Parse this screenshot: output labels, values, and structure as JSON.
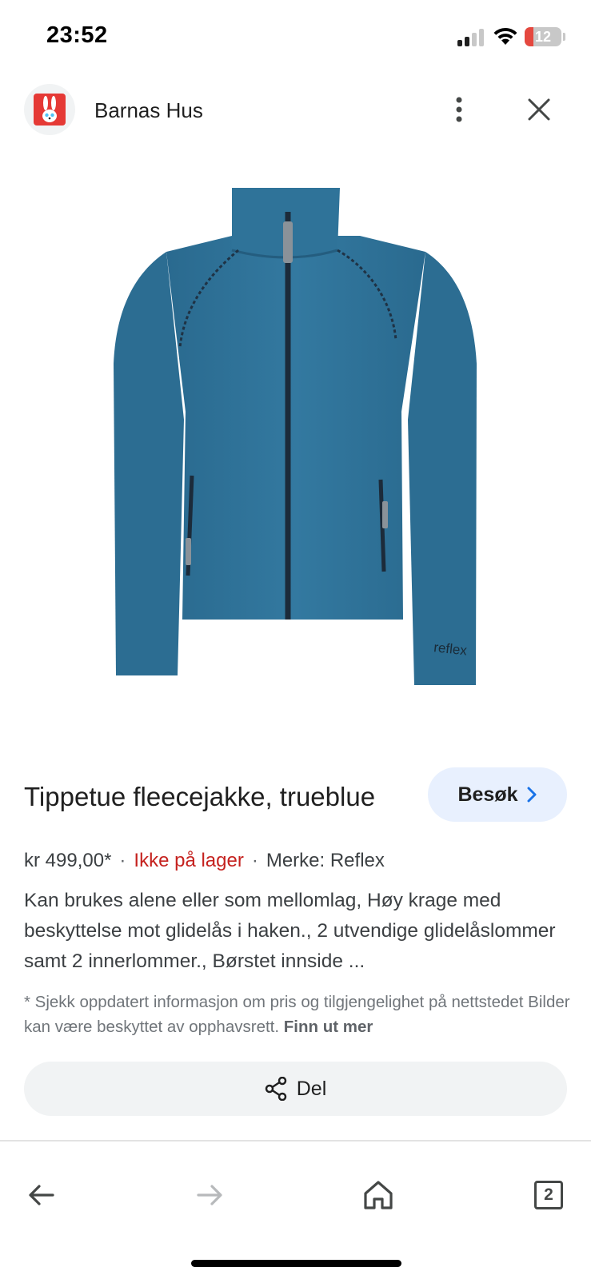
{
  "status_bar": {
    "time": "23:52",
    "battery_level": "12",
    "icons": [
      "signal-icon",
      "wifi-icon",
      "battery-icon"
    ]
  },
  "header": {
    "site_name": "Barnas Hus",
    "icons": [
      "site-logo-icon",
      "more-vert-icon",
      "close-icon"
    ]
  },
  "product": {
    "image_icon": "fleece-jacket-image",
    "image_logo_text": "reflex",
    "title": "Tippetue fleecejakke, trueblue",
    "visit_label": "Besøk",
    "price": "kr 499,00*",
    "separator": "·",
    "stock": "Ikke på lager",
    "brand": "Merke: Reflex",
    "description": "Kan brukes alene eller som mellomlag, Høy krage med beskyttelse mot glidelås i haken., 2 utvendige glidelåslommer samt 2 innerlommer., Børstet innside ...",
    "disclaimer": "* Sjekk oppdatert informasjon om pris og tilgjengelighet på nettstedet Bilder kan være beskyttet av opphavsrett.",
    "learn_more": "Finn ut mer"
  },
  "share": {
    "label": "Del"
  },
  "bottom_nav": {
    "tab_count": "2",
    "icons": [
      "back-arrow-icon",
      "forward-arrow-icon",
      "home-icon",
      "tabs-icon"
    ]
  },
  "colors": {
    "accent_blue": "#1a73e8",
    "stock_red": "#c5221f",
    "visit_bg": "#e8f0fe",
    "share_bg": "#f1f3f4",
    "jacket_blue": "#2e7096"
  }
}
